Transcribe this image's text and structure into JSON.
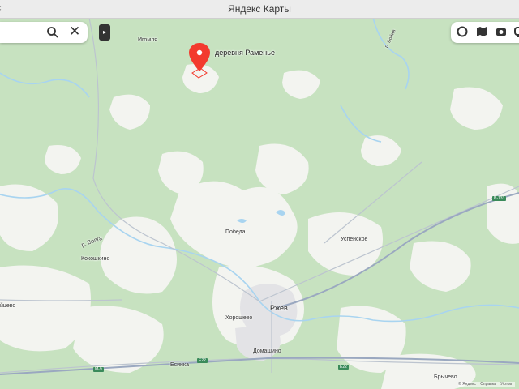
{
  "window": {
    "title": "Яндекс Карты",
    "left_fragment": "с"
  },
  "search": {
    "search_icon": "search-icon",
    "close_icon": "close-icon"
  },
  "panel_toggle_icon": "chevron-right-icon",
  "right_tools": [
    "layers-icon",
    "map-type-icon",
    "panorama-icon",
    "traffic-icon"
  ],
  "place": {
    "name": "деревня Раменье",
    "icon": "pin-icon"
  },
  "labels": {
    "igomya": "Игомля",
    "pobeda": "Победа",
    "uspenskoe": "Успенское",
    "kokoshkino": "Кокошкино",
    "rzhev": "Ржев",
    "khoroshevo": "Хорошево",
    "domashino": "Домашино",
    "esinka": "Есинка",
    "brycheve": "Брычево",
    "left_edge": "йцево",
    "river_volga": "р. Волга",
    "river_bossa": "р. Бойня"
  },
  "road_shields": {
    "r133": "Р-133",
    "e22_1": "E22",
    "e22_2": "E22",
    "m9": "М-9"
  },
  "copyright": {
    "brand": "© Яндекс",
    "help": "Справка",
    "terms": "Услов"
  },
  "colors": {
    "forest": "#c7e2c0",
    "field": "#f3f4f0",
    "water": "#a8d4f0",
    "road": "#bcc4cf",
    "pin": "#f33a2e",
    "major_road": "#9aa8c0"
  }
}
